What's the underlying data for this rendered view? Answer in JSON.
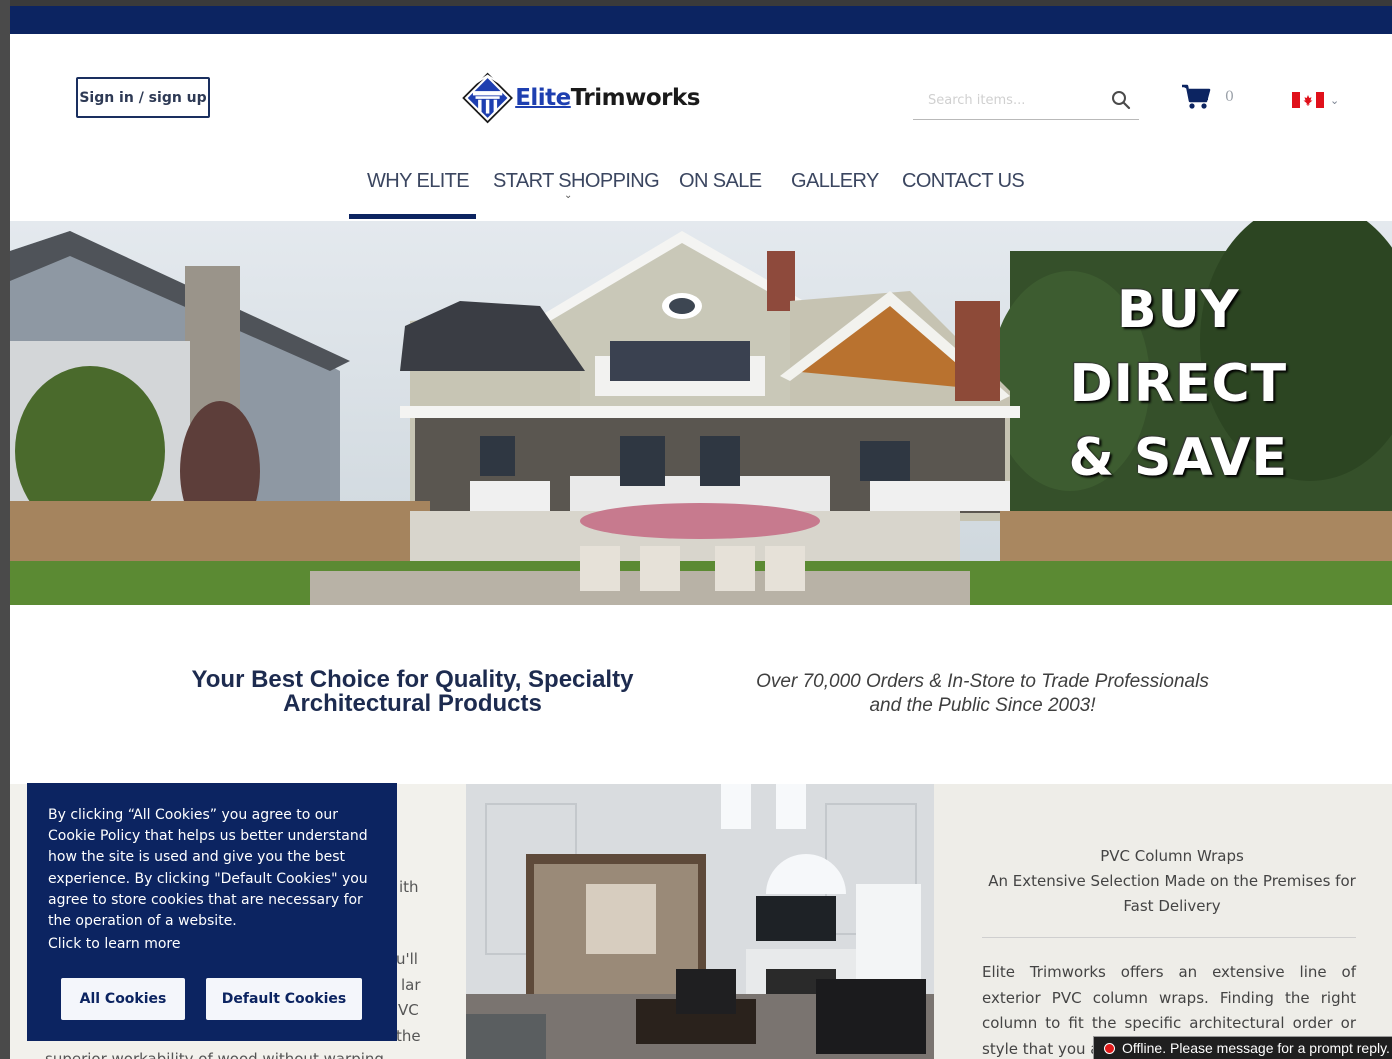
{
  "header": {
    "signin_label": "Sign in / sign up",
    "logo_text_part1": "Elite",
    "logo_text_part2": "Trimworks",
    "search_placeholder": "Search items...",
    "cart_count": "0",
    "flag": "canada-flag-icon"
  },
  "nav": {
    "items": [
      {
        "label": "WHY ELITE"
      },
      {
        "label": "START SHOPPING"
      },
      {
        "label": "ON SALE"
      },
      {
        "label": "GALLERY"
      },
      {
        "label": "CONTACT US"
      }
    ]
  },
  "hero": {
    "line1": "BUY",
    "line2": "DIRECT",
    "line3": "& SAVE"
  },
  "tagline": {
    "left": "Your Best Choice for Quality, Specialty Architectural Products",
    "right": "Over 70,000 Orders & In-Store to Trade Professionals and the Public Since 2003!"
  },
  "left_column": {
    "frag1": "ith",
    "frag2": "u'll",
    "frag3": "lar",
    "frag4": "VC",
    "frag5": "the",
    "frag6": "superior workability of wood without warping"
  },
  "right_column": {
    "title_line1": "PVC Column Wraps",
    "title_line2": "An Extensive Selection Made on the Premises for Fast Delivery",
    "body": "Elite Trimworks offers an extensive line of exterior PVC column wraps. Finding the right column to fit the specific architectural order or style that you are looking for"
  },
  "cookie": {
    "text": "By clicking “All Cookies” you agree to our Cookie Policy that helps us better understand how the site is used and give you the best experience. By clicking \"Default Cookies\" you agree to store cookies that are necessary for the operation of a website.",
    "learn_more": "Click to learn more",
    "all_label": "All Cookies",
    "default_label": "Default Cookies"
  },
  "chat": {
    "status": "Offline. Please message for a prompt reply."
  },
  "colors": {
    "brand_navy": "#0c2461",
    "logo_blue": "#1e3fb0",
    "offline_red": "#e01b1b"
  }
}
